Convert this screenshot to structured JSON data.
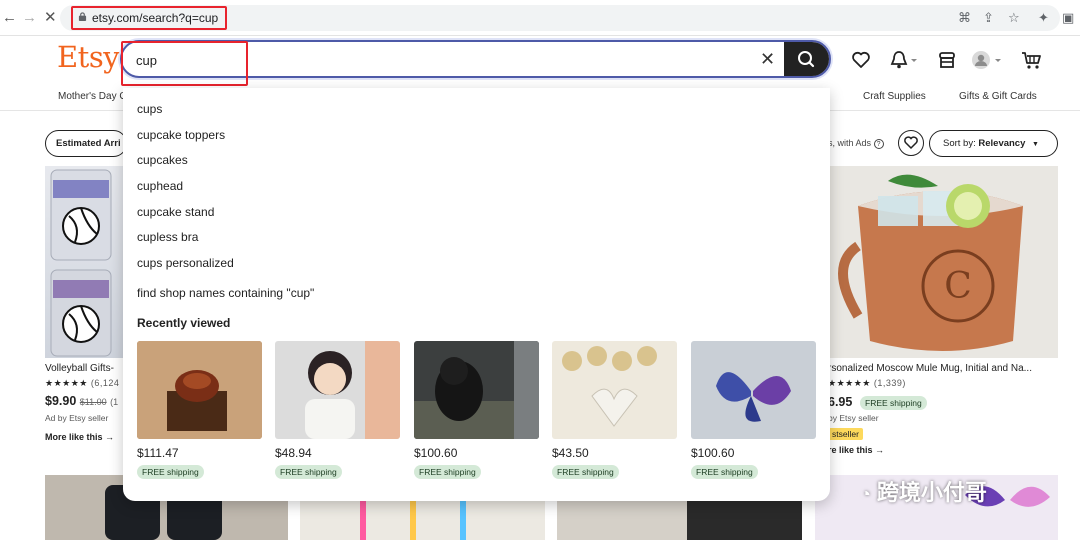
{
  "browser": {
    "back_icon": "back-arrow-icon",
    "forward_icon": "forward-arrow-icon",
    "close_icon": "close-icon",
    "url": "etsy.com/search?q=cup"
  },
  "header": {
    "logo": "Etsy",
    "search_value": "cup",
    "icons": [
      "clear-icon",
      "search-icon",
      "heart-icon",
      "bell-icon",
      "shop-icon",
      "avatar-icon",
      "cart-icon"
    ]
  },
  "categories": {
    "left": "Mother's Day G",
    "craft": "Craft Supplies",
    "gifts": "Gifts & Gift Cards"
  },
  "filters": {
    "estimated": "Estimated Arri",
    "ads_note": "s, with Ads",
    "sort_prefix": "Sort by: ",
    "sort_value": "Relevancy"
  },
  "suggestions": {
    "query": "cup",
    "items": [
      {
        "bold": "cup",
        "rest": "s"
      },
      {
        "bold": "cup",
        "rest": "cake toppers"
      },
      {
        "bold": "cup",
        "rest": "cakes"
      },
      {
        "bold": "cup",
        "rest": "head"
      },
      {
        "bold": "cup",
        "rest": "cake stand"
      },
      {
        "bold": "cup",
        "rest": "less bra"
      },
      {
        "bold": "cup",
        "rest": "s personalized"
      }
    ],
    "find_shops": "find shop names containing \"cup\"",
    "recently_viewed_title": "Recently viewed",
    "recently_viewed": [
      {
        "price": "$111.47",
        "shipping": "FREE shipping"
      },
      {
        "price": "$48.94",
        "shipping": "FREE shipping"
      },
      {
        "price": "$100.60",
        "shipping": "FREE shipping"
      },
      {
        "price": "$43.50",
        "shipping": "FREE shipping"
      },
      {
        "price": "$100.60",
        "shipping": "FREE shipping"
      }
    ]
  },
  "listings": {
    "left": {
      "title": "Volleyball Gifts-",
      "stars": "★★★★★",
      "reviews": "(6,124",
      "price": "$9.90",
      "orig_price": "$11.00",
      "orig_rest": "(1",
      "ad": "Ad by Etsy seller",
      "more": "More like this"
    },
    "right": {
      "title": "rsonalized Moscow Mule Mug, Initial and Na...",
      "stars": "★★★★★",
      "reviews": "(1,339)",
      "price": "6.95",
      "shipping": "FREE shipping",
      "ad": "by Etsy seller",
      "badge": "stseller",
      "more": "re like this"
    }
  },
  "watermark": "跨境小付哥",
  "colors": {
    "etsy_orange": "#f1641e",
    "highlight_red": "#e8232d",
    "focus_blue": "#4e5aa8",
    "free_green": "#d4e9d7"
  }
}
